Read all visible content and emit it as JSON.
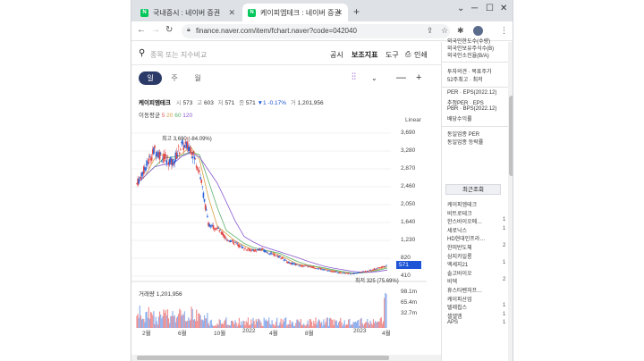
{
  "browser": {
    "tabs": [
      {
        "label": "국내증시 : 네이버 증권",
        "active": false
      },
      {
        "label": "케이피엠테크 : 네이버 증권",
        "active": true
      }
    ],
    "url": "finance.naver.com/item/fchart.naver?code=042040"
  },
  "search": {
    "placeholder": "종목 또는 지수비교"
  },
  "top_menu": [
    "공시",
    "보조지표",
    "도구",
    "인쇄"
  ],
  "periods": [
    "일",
    "주",
    "월"
  ],
  "selected_period": "일",
  "stock": {
    "name": "케이피엠테크",
    "open_label": "시",
    "open": "573",
    "high_label": "고",
    "high": "603",
    "low_label": "저",
    "low": "571",
    "close_label": "종",
    "close": "571",
    "change": "▼1",
    "change_pct": "-0.17%",
    "volume_label": "거",
    "volume": "1,201,956"
  },
  "moving_avg": {
    "label": "이동평균",
    "periods": [
      "5",
      "20",
      "60",
      "120"
    ]
  },
  "scale_label": "Linear",
  "annotations": {
    "high": "최고 3,690 (-84.09%)",
    "low": "최저 325 (75.69%)",
    "volume": "거래량 1,201,956",
    "last_price": "571"
  },
  "chart_data": {
    "type": "line",
    "title": "",
    "xlabel": "",
    "ylabel": "",
    "ylim": [
      325,
      3690
    ],
    "y_ticks": [
      "3,690",
      "3,280",
      "2,870",
      "2,460",
      "2,050",
      "1,640",
      "1,230",
      "820",
      "410"
    ],
    "volume_ticks": [
      "98.1m",
      "65.4m",
      "32.7m"
    ],
    "x_ticks": [
      "2월",
      "6월",
      "10월",
      "2022",
      "4월",
      "8월",
      "2023",
      "4월"
    ],
    "series": [
      {
        "name": "",
        "x": [
          "2021-01",
          "2021-02",
          "2021-03",
          "2021-04",
          "2021-05",
          "2021-06",
          "2021-07",
          "2021-08",
          "2021-09",
          "2021-10",
          "2021-11",
          "2021-12",
          "2022-01",
          "2022-02",
          "2022-03",
          "2022-04",
          "2022-05",
          "2022-06",
          "2022-07",
          "2022-08",
          "2022-09",
          "2022-10",
          "2022-11",
          "2022-12",
          "2023-01",
          "2023-02",
          "2023-03",
          "2023-04",
          "2023-05"
        ],
        "values": [
          2500,
          2900,
          3300,
          3100,
          3000,
          3400,
          3350,
          2800,
          1550,
          1450,
          1200,
          1100,
          980,
          920,
          950,
          850,
          780,
          640,
          580,
          560,
          520,
          470,
          430,
          400,
          380,
          420,
          450,
          520,
          571
        ]
      }
    ]
  },
  "side_panel": {
    "top_items": [
      "외국인한도수(수량)",
      "외국인보유주식수(B)",
      "외국인소진율(B/A)"
    ],
    "mid_items": [
      "투자의견 · 목표주가",
      "52주최고 · 최저"
    ],
    "ratio_items": [
      "PER · EPS(2022.12)",
      "추정PER · EPS",
      "PBR · BPS(2022.12)",
      "배당수익률"
    ],
    "sector_items": [
      "동일업종 PER",
      "동일업종 등락률"
    ],
    "recent_tab": "최근조회",
    "recent": [
      {
        "name": "케이피엠테크",
        "count": ""
      },
      {
        "name": "비트로테크",
        "count": ""
      },
      {
        "name": "한스바이오메…",
        "count": "1"
      },
      {
        "name": "세로닉스",
        "count": "1"
      },
      {
        "name": "HD현대인프라…",
        "count": ""
      },
      {
        "name": "한미반도체",
        "count": "2"
      },
      {
        "name": "삼지카일롱",
        "count": ""
      },
      {
        "name": "엑세지21",
        "count": "1"
      },
      {
        "name": "솔고바이오",
        "count": ""
      },
      {
        "name": "비덱",
        "count": "2"
      },
      {
        "name": "휴스타벤처프…",
        "count": ""
      },
      {
        "name": "케이피산업",
        "count": ""
      },
      {
        "name": "텔레칩스",
        "count": "1"
      },
      {
        "name": "셀엘엠",
        "count": "1"
      },
      {
        "name": "APS",
        "count": "1"
      }
    ]
  }
}
